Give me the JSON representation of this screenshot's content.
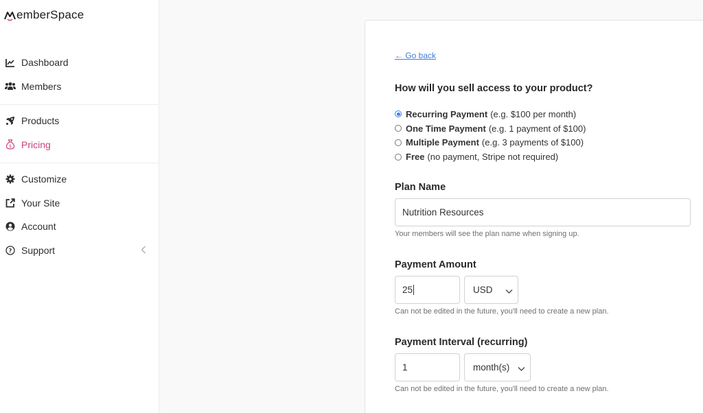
{
  "app": {
    "brand": "MemberSpace",
    "brand_accent": "#c8427e"
  },
  "sidebar": {
    "groups": [
      [
        {
          "label": "Dashboard",
          "icon": "chart-line-icon",
          "active": false
        },
        {
          "label": "Members",
          "icon": "users-icon",
          "active": false
        }
      ],
      [
        {
          "label": "Products",
          "icon": "rocket-icon",
          "active": false
        },
        {
          "label": "Pricing",
          "icon": "money-bag-icon",
          "active": true
        }
      ],
      [
        {
          "label": "Customize",
          "icon": "gear-icon",
          "active": false
        },
        {
          "label": "Your Site",
          "icon": "external-link-icon",
          "active": false
        },
        {
          "label": "Account",
          "icon": "user-circle-icon",
          "active": false
        },
        {
          "label": "Support",
          "icon": "question-circle-icon",
          "active": false
        }
      ]
    ],
    "collapse_icon": "chevron-left-icon"
  },
  "form": {
    "go_back": "← Go back",
    "question": "How will you sell access to your product?",
    "options": [
      {
        "title": "Recurring Payment",
        "desc": "(e.g. $100 per month)",
        "checked": true
      },
      {
        "title": "One Time Payment",
        "desc": "(e.g. 1 payment of $100)",
        "checked": false
      },
      {
        "title": "Multiple Payment",
        "desc": "(e.g. 3 payments of $100)",
        "checked": false
      },
      {
        "title": "Free",
        "desc": "(no payment, Stripe not required)",
        "checked": false
      }
    ],
    "plan_name": {
      "label": "Plan Name",
      "value": "Nutrition Resources",
      "help": "Your members will see the plan name when signing up."
    },
    "payment_amount": {
      "label": "Payment Amount",
      "value": "25",
      "currency": "USD",
      "help": "Can not be edited in the future, you'll need to create a new plan."
    },
    "payment_interval": {
      "label": "Payment Interval (recurring)",
      "value": "1",
      "unit": "month(s)",
      "help": "Can not be edited in the future, you'll need to create a new plan."
    }
  }
}
